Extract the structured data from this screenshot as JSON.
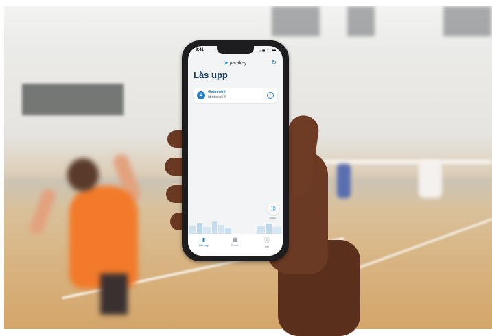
{
  "status_bar": {
    "time": "9:41",
    "icons": "▂▄ ◠ ▬"
  },
  "header": {
    "brand": "parakey",
    "refresh_icon": "refresh-icon"
  },
  "page": {
    "title": "Lås upp"
  },
  "locks": [
    {
      "name": "Gatuentré",
      "location": "Idrottshall X"
    }
  ],
  "nfc": {
    "label": "NFC"
  },
  "tabs": [
    {
      "label": "Lås upp",
      "active": true
    },
    {
      "label": "Platser",
      "active": false
    },
    {
      "label": "Info",
      "active": false
    }
  ],
  "colors": {
    "accent": "#2a7fc4",
    "title": "#1b3f66",
    "screen_bg": "#f2f4f5"
  }
}
